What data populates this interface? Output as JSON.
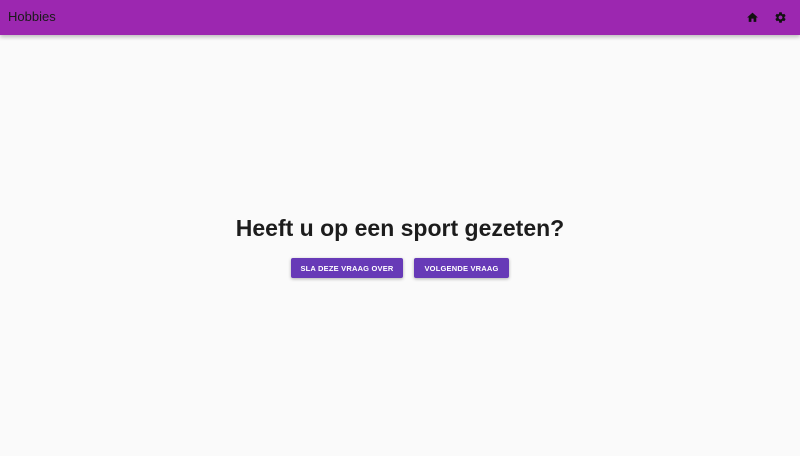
{
  "app_bar": {
    "title": "Hobbies",
    "background_color": "#9c27b0",
    "actions": [
      {
        "icon": "home-icon"
      },
      {
        "icon": "gear-icon"
      }
    ]
  },
  "main": {
    "question": "Heeft u op een sport gezeten?",
    "buttons": {
      "skip_label": "SLA DEZE VRAAG OVER",
      "next_label": "VOLGENDE VRAAG",
      "color": "#673ab7"
    }
  }
}
